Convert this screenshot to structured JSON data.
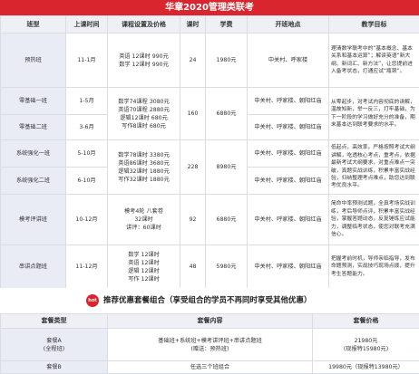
{
  "title": "华章2020管理类联考",
  "headers": [
    "班型",
    "上课时间",
    "课程设置及价格",
    "课时",
    "学费",
    "开班地点",
    "教学目标"
  ],
  "rows": [
    {
      "name": "预热班",
      "time": "11-1月",
      "courses": [
        "英语 12课时 990元",
        "数学 12课时 990元"
      ],
      "hours": "24",
      "fee": "1980元",
      "location": "中关村、呼家楼",
      "goal": "理清数学联考中的“基本概念、基本关系和基本运算”；解读英语“新大纲、新词汇、新方法”，让您提前进入备考状态，打通应试“瓶颈”。"
    },
    {
      "name": "零基础一班",
      "time": "1-5月",
      "courses": [
        "数学74课程 3080元",
        "英语70课程 2880元",
        "逻辑12课时 680元",
        "写作8课时 680元"
      ],
      "hours": "160",
      "fee": "6880元",
      "location": "中关村、呼家楼、朝阳红庙",
      "goal": "从零起步，对考试内容彻底的讲解，温故知新，举一反三，打牢基础，为下一阶段的学习做好充分的准备，期末基本达到联考要求的水平。"
    },
    {
      "name": "零基础二班",
      "time": "3-6月",
      "location": "中关村、呼家楼、朝阳红庙"
    },
    {
      "name": "系统强化一班",
      "time": "5-10月",
      "courses": [
        "数学78课时 3380元",
        "英语86课时 3680元",
        "逻辑32课时 1880元",
        "写作32课时 1880元"
      ],
      "hours": "228",
      "fee": "8980元",
      "location": "中关村、呼家楼、朝阳红庙",
      "goal": "低起点，高效率。严格按照考试大纲讲解，吃透核心考点，重考点，依据最新考试大纲要求，对重点难点一突破，真题实战训练，积累丰富实战经验，归纳整理考点难点，助您达到联考优良水平。"
    },
    {
      "name": "系统强化二班",
      "time": "6-10月",
      "location": "中关村、呼家楼、朝阳红庙"
    },
    {
      "name": "模考评讲班",
      "time": "10-12月",
      "courses": [
        "模考4轮 八套卷",
        "32课时",
        "讲评：60课时"
      ],
      "hours": "92",
      "fee": "6880元",
      "location": "中关村、呼家楼、朝阳红庙",
      "goal": "简命中率预测试题，全真考场实战训练，考后导师点评，积累丰富实战经验，掌握答题动态，反复锤炼应试能力，调整临考状态，使您对联考充满信心。"
    },
    {
      "name": "串讲点题班",
      "time": "11-12月",
      "courses": [
        "数学 12课时",
        "英语 12课时",
        "逻辑 12课时",
        "写作 12课时"
      ],
      "hours": "48",
      "fee": "5980元",
      "location": "中关村、呼家楼、朝阳红庙",
      "goal": "把握考前时机，导师亲临指导，发布命题预测，实战技巧现场点拨，提升考生答题能力。"
    }
  ],
  "promo": {
    "badge": "hot",
    "title": "推荐优惠套餐组合（享受组合的学员不再同时享受其他优惠）"
  },
  "combo_headers": [
    "套餐类型",
    "套餐内容",
    "套餐价格"
  ],
  "combos": [
    {
      "name": "套餐A",
      "name2": "(全程班)",
      "content": "基础班+系统班+模考讲评班+串讲点题班",
      "content2": "(赠送：预热班)",
      "price": "21980元",
      "price2": "(现报特15980元)"
    },
    {
      "name": "套餐B",
      "content": "任选三个班组合",
      "price": "19980元（现报特13980元）"
    }
  ],
  "colors": {
    "accent": "#d9262e",
    "header_bg": "#eef0f6",
    "name_bg": "#e9ebf5",
    "border": "#d9dde6"
  }
}
